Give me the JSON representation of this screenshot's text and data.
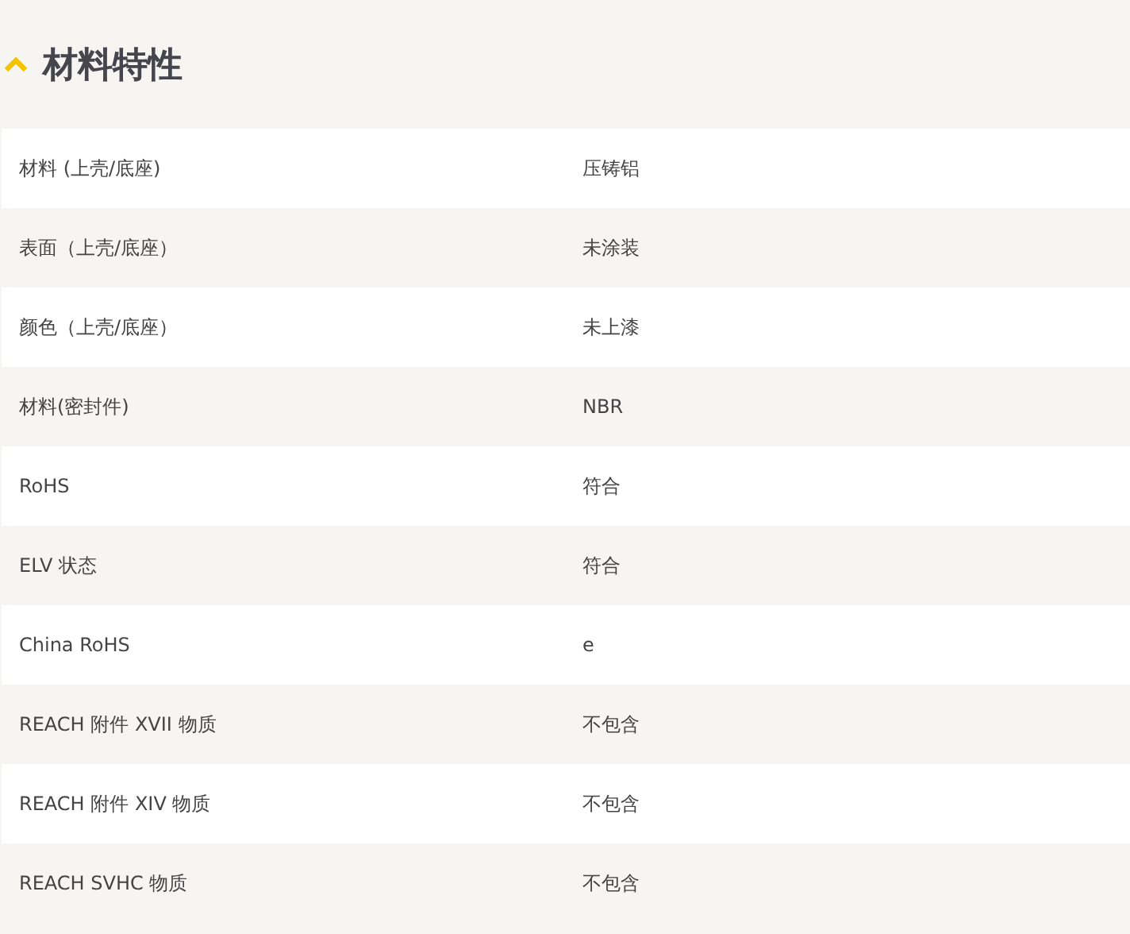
{
  "section": {
    "title": "材料特性",
    "expanded": true
  },
  "table": {
    "rows": [
      {
        "label": "材料 (上壳/底座)",
        "value": "压铸铝"
      },
      {
        "label": "表面（上壳/底座）",
        "value": "未涂装"
      },
      {
        "label": "颜色（上壳/底座）",
        "value": "未上漆"
      },
      {
        "label": "材料(密封件)",
        "value": "NBR"
      },
      {
        "label": "RoHS",
        "value": "符合"
      },
      {
        "label": "ELV 状态",
        "value": "符合"
      },
      {
        "label": "China RoHS",
        "value": "e"
      },
      {
        "label": "REACH 附件 XVII 物质",
        "value": "不包含"
      },
      {
        "label": "REACH 附件 XIV 物质",
        "value": "不包含"
      },
      {
        "label": "REACH SVHC 物质",
        "value": "不包含"
      }
    ]
  }
}
